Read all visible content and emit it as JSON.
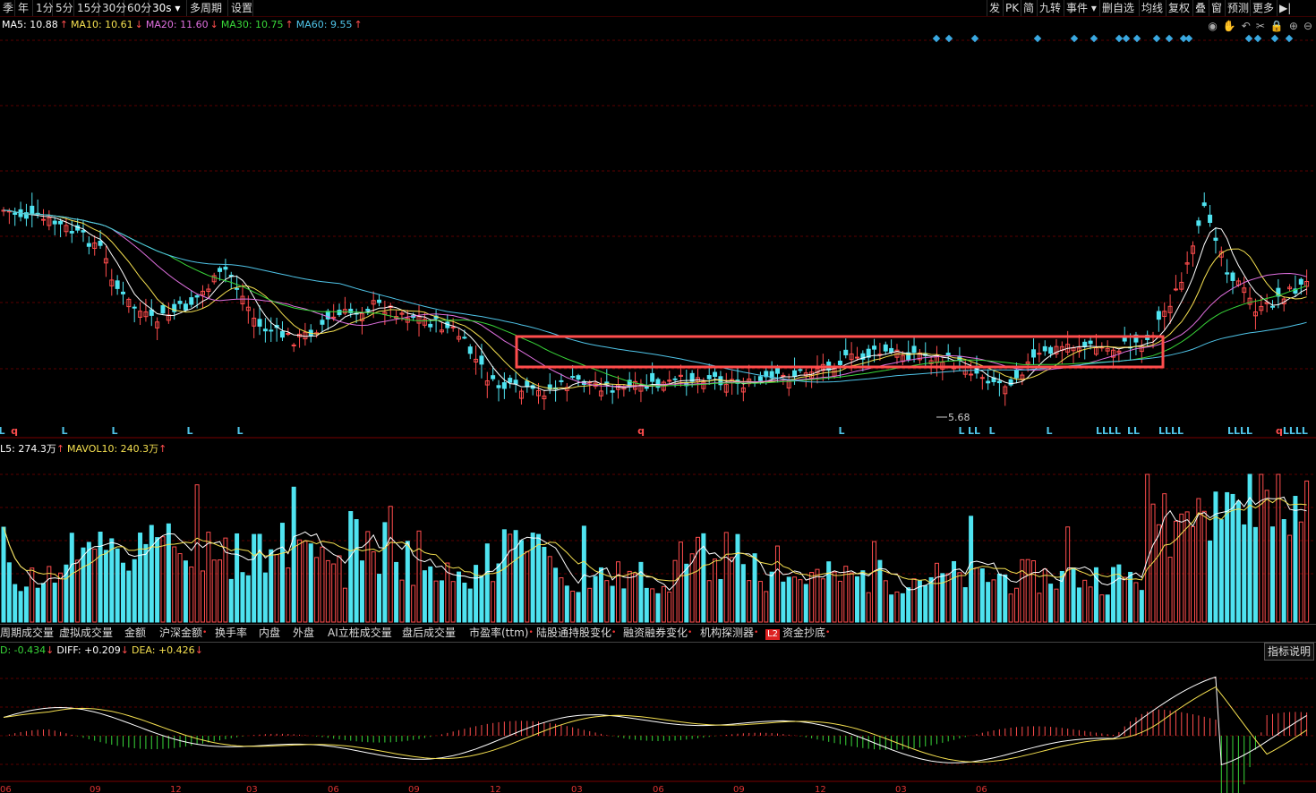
{
  "toolbar": {
    "periods": [
      "季",
      "年",
      "1分",
      "5分",
      "15分",
      "30分",
      "60分",
      "30s",
      "多周期",
      "设置"
    ],
    "active_period": "30s",
    "right_buttons": [
      "发",
      "PK",
      "简",
      "九转",
      "事件",
      "删自选",
      "均线",
      "复权",
      "叠",
      "窗",
      "预测",
      "更多"
    ]
  },
  "ma_legend": [
    {
      "label": "MA5: 10.88",
      "arrow": "↑",
      "color": "#ffffff"
    },
    {
      "label": "MA10: 10.61",
      "arrow": "↓",
      "color": "#f5e050"
    },
    {
      "label": "MA20: 11.60",
      "arrow": "↓",
      "color": "#e070e0"
    },
    {
      "label": "MA30: 10.75",
      "arrow": "↑",
      "color": "#39d739"
    },
    {
      "label": "MA60: 9.55",
      "arrow": "↑",
      "color": "#4fc4e8"
    }
  ],
  "icons": [
    "eye-icon",
    "hand-icon",
    "undo-icon",
    "scissors-icon",
    "lock-icon",
    "zoom-in-icon",
    "zoom-out-icon"
  ],
  "icon_glyphs": [
    "◉",
    "✋",
    "↶",
    "✂",
    "🔒",
    "⊕",
    "⊖"
  ],
  "price_annotation": "5.68",
  "signal_marks": {
    "q": [
      "q"
    ],
    "L": [
      "L"
    ]
  },
  "volume_legend": [
    {
      "label": "L5: 274.3万",
      "arrow": "↑",
      "color": "#ffffff"
    },
    {
      "label": "MAVOL10: 240.3万",
      "arrow": "↑",
      "color": "#f5e050"
    }
  ],
  "indicator_tabs": [
    {
      "label": "周期成交量",
      "dot": false
    },
    {
      "label": "虚拟成交量",
      "dot": false
    },
    {
      "label": "金额",
      "dot": false
    },
    {
      "label": "沪深金额",
      "dot": true
    },
    {
      "label": "换手率",
      "dot": false
    },
    {
      "label": "内盘",
      "dot": false
    },
    {
      "label": "外盘",
      "dot": false
    },
    {
      "label": "AI立桩成交量",
      "dot": false
    },
    {
      "label": "盘后成交量",
      "dot": false
    },
    {
      "label": "市盈率(ttm)",
      "dot": true
    },
    {
      "label": "陆股通持股变化",
      "dot": true
    },
    {
      "label": "融资融券变化",
      "dot": true
    },
    {
      "label": "机构探测器",
      "dot": true
    },
    {
      "label": "资金抄底",
      "dot": true,
      "badge": "L2"
    }
  ],
  "help_button": "指标说明",
  "macd_legend": [
    {
      "label": "D: -0.434",
      "arrow": "↓",
      "color": "#39d739"
    },
    {
      "label": "DIFF: +0.209",
      "arrow": "↓",
      "color": "#ffffff"
    },
    {
      "label": "DEA: +0.426",
      "arrow": "↓",
      "color": "#f5e050"
    }
  ],
  "x_labels": [
    "06",
    "09",
    "12",
    "03",
    "06",
    "09",
    "12",
    "03",
    "06",
    "09",
    "12",
    "03",
    "06"
  ],
  "colors": {
    "up": "#ff4d4d",
    "down": "#4fe3f0",
    "highlight_box": "#ff4d4d",
    "grid": "#5a0000"
  }
}
